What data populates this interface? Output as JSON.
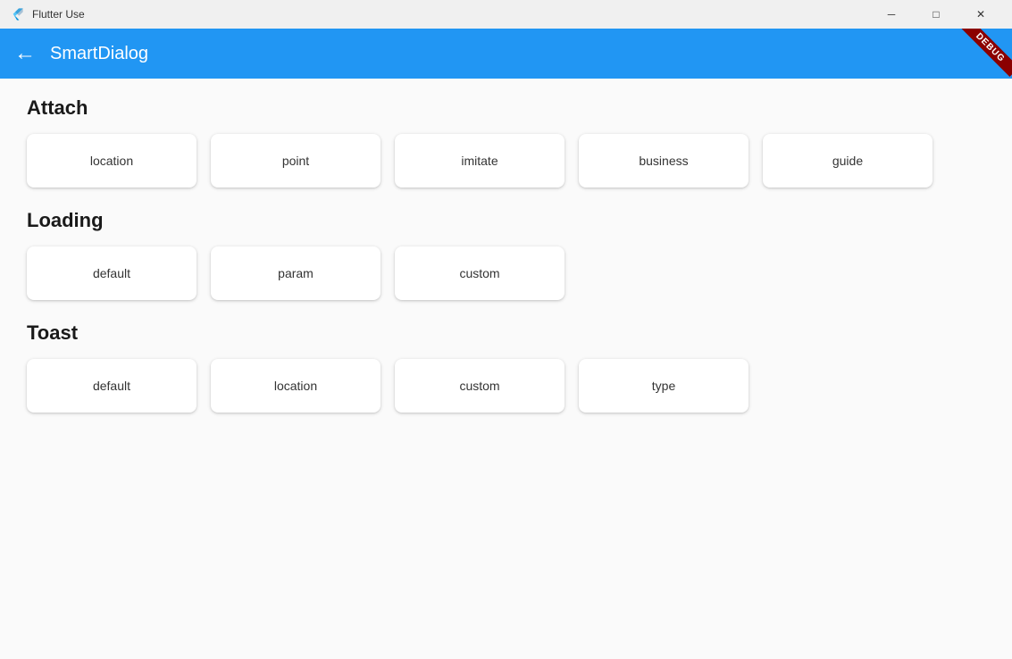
{
  "titlebar": {
    "app_name": "Flutter Use",
    "minimize_label": "─",
    "maximize_label": "□",
    "close_label": "✕"
  },
  "appbar": {
    "back_label": "←",
    "title": "SmartDialog",
    "debug_label": "DEBUG"
  },
  "sections": [
    {
      "id": "attach",
      "title": "Attach",
      "buttons": [
        {
          "id": "attach-location",
          "label": "location"
        },
        {
          "id": "attach-point",
          "label": "point"
        },
        {
          "id": "attach-imitate",
          "label": "imitate"
        },
        {
          "id": "attach-business",
          "label": "business"
        },
        {
          "id": "attach-guide",
          "label": "guide"
        }
      ]
    },
    {
      "id": "loading",
      "title": "Loading",
      "buttons": [
        {
          "id": "loading-default",
          "label": "default"
        },
        {
          "id": "loading-param",
          "label": "param"
        },
        {
          "id": "loading-custom",
          "label": "custom"
        }
      ]
    },
    {
      "id": "toast",
      "title": "Toast",
      "buttons": [
        {
          "id": "toast-default",
          "label": "default"
        },
        {
          "id": "toast-location",
          "label": "location"
        },
        {
          "id": "toast-custom",
          "label": "custom"
        },
        {
          "id": "toast-type",
          "label": "type"
        }
      ]
    }
  ]
}
